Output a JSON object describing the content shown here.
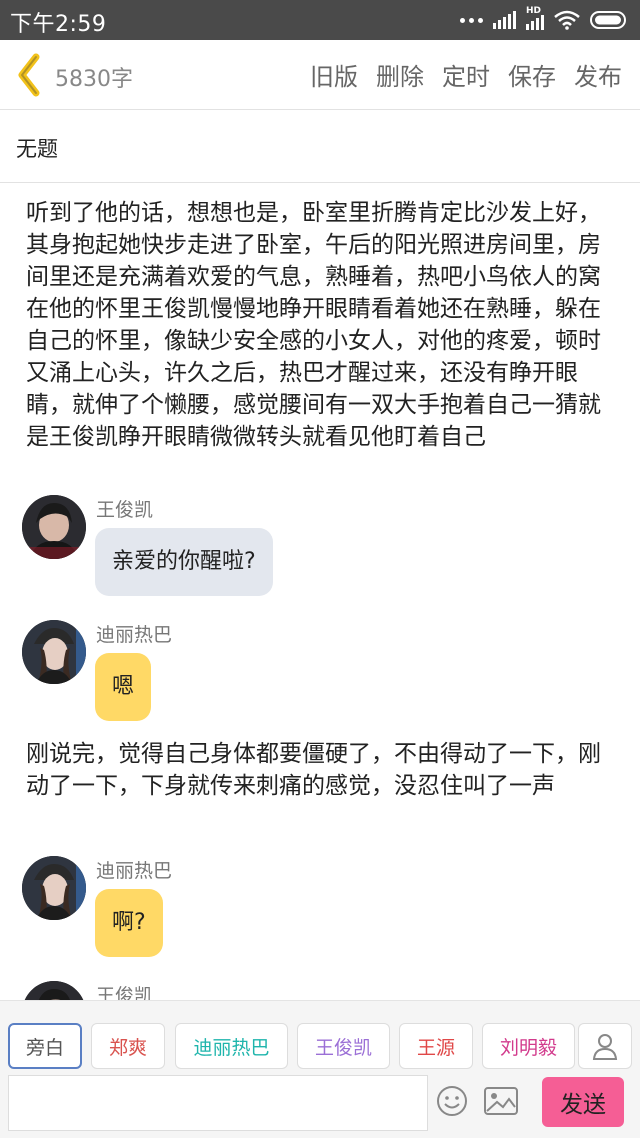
{
  "status_bar": {
    "time": "下午2:59",
    "network": "HD"
  },
  "header": {
    "word_count": "5830字",
    "actions": [
      "旧版",
      "删除",
      "定时",
      "保存",
      "发布"
    ]
  },
  "title": "无题",
  "content": {
    "paragraph1": "听到了他的话，想想也是，卧室里折腾肯定比沙发上好，其身抱起她快步走进了卧室，午后的阳光照进房间里，房间里还是充满着欢爱的气息，熟睡着，热吧小鸟依人的窝在他的怀里王俊凯慢慢地睁开眼睛看着她还在熟睡，躲在自己的怀里，像缺少安全感的小女人，对他的疼爱，顿时又涌上心头，许久之后，热巴才醒过来，还没有睁开眼睛，就伸了个懒腰，感觉腰间有一双大手抱着自己一猜就是王俊凯睁开眼睛微微转头就看见他盯着自己",
    "messages": [
      {
        "speaker": "王俊凯",
        "text": "亲爱的你醒啦?",
        "bubble_color": "#e3e7ee"
      },
      {
        "speaker": "迪丽热巴",
        "text": "嗯",
        "bubble_color": "#ffd966"
      }
    ],
    "paragraph2": "刚说完，觉得自己身体都要僵硬了，不由得动了一下，刚动了一下，下身就传来刺痛的感觉，没忍住叫了一声",
    "messages2": [
      {
        "speaker": "迪丽热巴",
        "text": "啊?",
        "bubble_color": "#ffd966"
      },
      {
        "speaker": "王俊凯",
        "text": ""
      }
    ]
  },
  "role_chips": [
    {
      "label": "旁白",
      "color": "#666666"
    },
    {
      "label": "郑爽",
      "color": "#d9534f"
    },
    {
      "label": "迪丽热巴",
      "color": "#1fb5ac"
    },
    {
      "label": "王俊凯",
      "color": "#9b6fd6"
    },
    {
      "label": "王源",
      "color": "#e04848"
    },
    {
      "label": "刘明毅",
      "color": "#d23a8c"
    }
  ],
  "composer": {
    "placeholder": "",
    "send_label": "发送"
  },
  "colors": {
    "send_button": "#f55e95",
    "back_arrow": "#f2c21a",
    "active_chip_border": "#5a7fc4"
  }
}
